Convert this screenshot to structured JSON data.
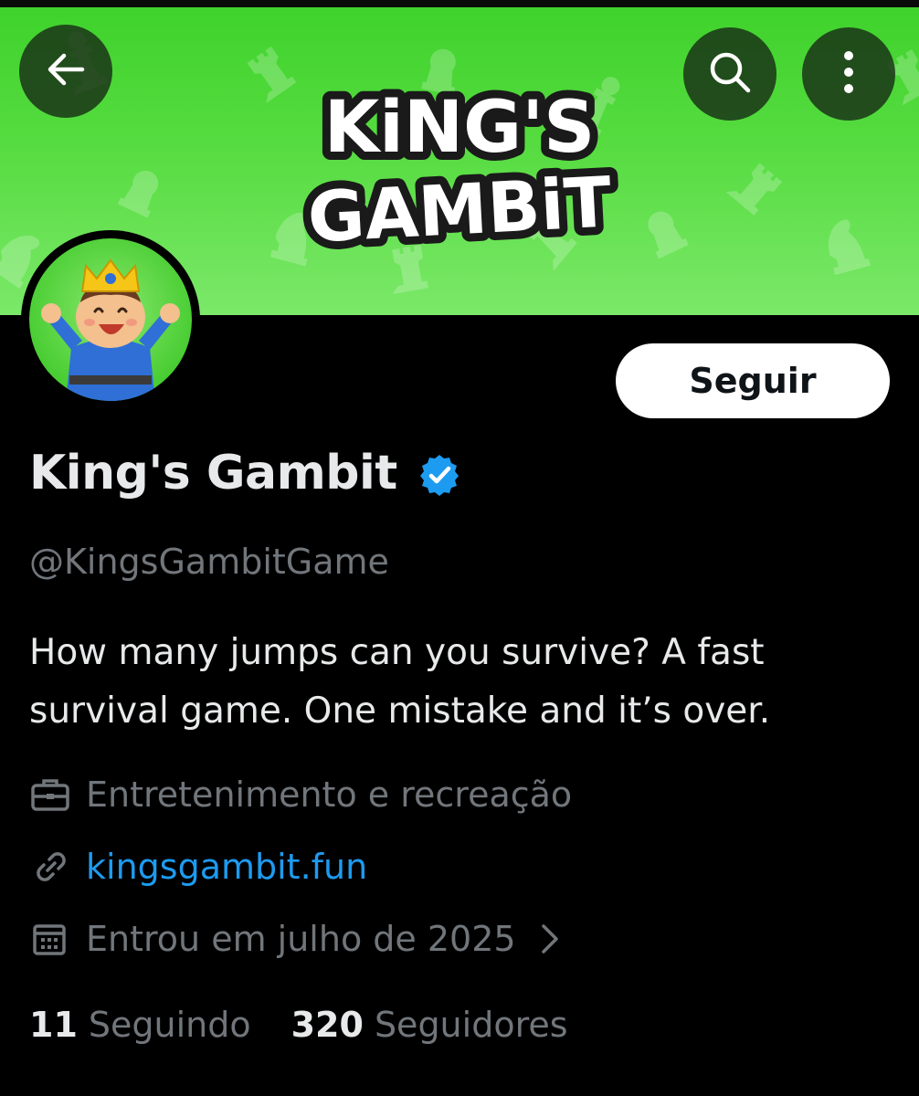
{
  "banner": {
    "logo_line1": "KiNG'S",
    "logo_line2": "GAMBiT"
  },
  "header_buttons": {
    "back": "arrow-left-icon",
    "search": "search-icon",
    "more": "more-vertical-icon"
  },
  "profile": {
    "display_name": "King's Gambit",
    "verified": true,
    "handle": "@KingsGambitGame",
    "bio": "How many jumps can you survive? A fast survival game. One mistake and it’s over.",
    "follow_label": "Seguir",
    "category": "Entretenimento e recreação",
    "website": "kingsgambit.fun",
    "joined": "Entrou em julho de 2025"
  },
  "stats": {
    "following_count": "11",
    "following_label": "Seguindo",
    "followers_count": "320",
    "followers_label": "Seguidores"
  },
  "colors": {
    "background": "#000000",
    "banner_green": "#56dc40",
    "link_blue": "#1d9bf0",
    "verified_blue": "#1d9bf0",
    "muted_text": "#71767b",
    "primary_text": "#e7e9ea",
    "follow_button_bg": "#ffffff"
  }
}
